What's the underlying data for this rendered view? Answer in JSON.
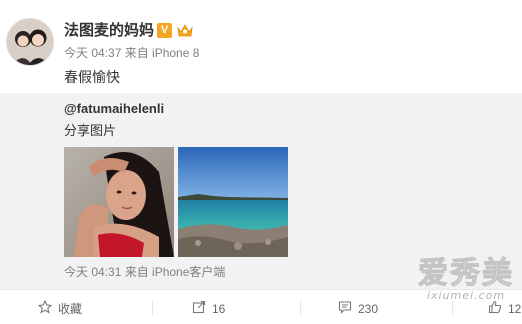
{
  "post": {
    "username": "法图麦的妈妈",
    "verified_badge": "V",
    "level_icon": "crown-badge-icon",
    "meta": "今天 04:37 来自 iPhone 8",
    "text": "春假愉快"
  },
  "repost": {
    "username": "@fatumaihelenli",
    "text": "分享图片",
    "photos": [
      {
        "name": "selfie-photo",
        "description_icon": "photo"
      },
      {
        "name": "sea-photo",
        "description_icon": "photo"
      }
    ],
    "meta": "今天 04:31 来自 iPhone客户端"
  },
  "actions": {
    "favorite_label": "收藏",
    "repost_count": "16",
    "comment_count": "230",
    "like_count": "12"
  },
  "watermark": {
    "main": "爱秀美",
    "sub": "ixiumei.com"
  },
  "colors": {
    "repost_bg": "#f2f2f5",
    "meta_text": "#808080",
    "badge": "#f5a623"
  }
}
